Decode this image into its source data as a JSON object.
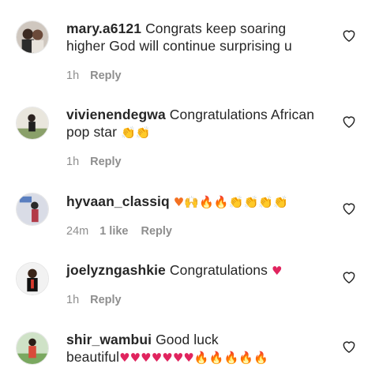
{
  "icons": {
    "like": "heart-outline-icon",
    "avatar": "profile-photo"
  },
  "colors": {
    "text": "#262626",
    "meta": "#8e8e8e",
    "heart": "#e0245e",
    "fire": "#f37021",
    "clap": "#f6b719"
  },
  "comments": [
    {
      "username": "mary.a6121",
      "text": "Congrats keep soaring higher God will continue surprising u",
      "time": "1h",
      "likes": "",
      "reply": "Reply"
    },
    {
      "username": "vivienendegwa",
      "text": "Congratulations African pop star",
      "emoji": "👏👏",
      "time": "1h",
      "likes": "",
      "reply": "Reply"
    },
    {
      "username": "hyvaan_classiq",
      "text": "",
      "emoji": "♥🙌🔥🔥👏👏👏👏",
      "time": "24m",
      "likes": "1 like",
      "reply": "Reply"
    },
    {
      "username": "joelyzngashkie",
      "text": "Congratulations",
      "emoji": "♥",
      "time": "1h",
      "likes": "",
      "reply": "Reply"
    },
    {
      "username": "shir_wambui",
      "text": "Good luck beautiful",
      "emoji": "♥♥♥♥♥♥♥🔥🔥🔥🔥🔥",
      "time": "",
      "likes": "",
      "reply": ""
    }
  ]
}
